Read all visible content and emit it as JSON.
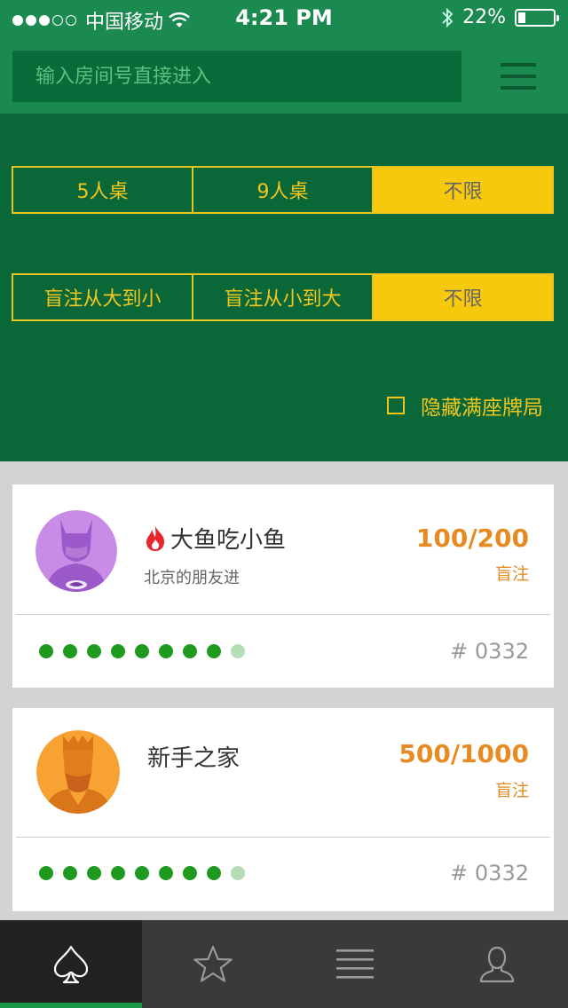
{
  "status_bar": {
    "carrier": "中国移动",
    "time": "4:21 PM",
    "battery": "22%",
    "battery_level": 0.22
  },
  "header": {
    "search_placeholder": "输入房间号直接进入",
    "menu_icon": "hamburger-menu-icon"
  },
  "filters": {
    "table_size": {
      "options": [
        "5人桌",
        "9人桌",
        "不限"
      ],
      "selected": "不限"
    },
    "blind_order": {
      "options": [
        "盲注从大到小",
        "盲注从小到大",
        "不限"
      ],
      "selected": "不限"
    },
    "hide_full_label": "隐藏满座牌局"
  },
  "rooms": [
    {
      "name": "大鱼吃小鱼",
      "subtitle": "北京的朋友进",
      "blinds": "100/200",
      "blinds_label": "盲注",
      "room_number": "# 0332",
      "seats_taken": 8,
      "seats_total": 9,
      "hot": true,
      "avatar_icon": "batman-avatar-icon"
    },
    {
      "name": "新手之家",
      "subtitle": "",
      "blinds": "500/1000",
      "blinds_label": "盲注",
      "room_number": "# 0332",
      "seats_taken": 8,
      "seats_total": 9,
      "hot": false,
      "avatar_icon": "king-avatar-icon"
    }
  ],
  "tabs": [
    {
      "icon": "spade-icon",
      "active": true
    },
    {
      "icon": "star-icon",
      "active": false
    },
    {
      "icon": "list-icon",
      "active": false
    },
    {
      "icon": "user-icon",
      "active": false
    }
  ],
  "colors": {
    "header_green": "#1a8a50",
    "panel_green": "#0a6738",
    "accent_yellow": "#f6c90c",
    "blind_orange": "#e68a21",
    "seat_green": "#1f9a1f"
  }
}
